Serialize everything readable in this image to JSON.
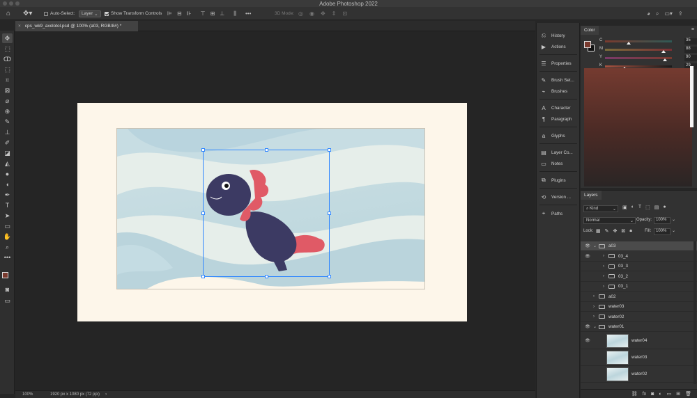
{
  "app": {
    "title": "Adobe Photoshop 2022"
  },
  "options_bar": {
    "auto_select_label": "Auto-Select:",
    "auto_select_value": "Layer",
    "show_transform_label": "Show Transform Controls",
    "mode_3d_label": "3D Mode:"
  },
  "document": {
    "tab_label": "cps_wk9_axolotol.psd @ 100% (a03, RGB/8#) *",
    "zoom": "100%",
    "dimensions": "1920 px x 1080 px (72 ppi)"
  },
  "dock": [
    {
      "label": "History",
      "icon": "history-icon"
    },
    {
      "label": "Actions",
      "icon": "play-icon"
    },
    {
      "label": "Properties",
      "icon": "sliders-icon"
    },
    {
      "label": "Brush Set...",
      "icon": "brush-icon"
    },
    {
      "label": "Brushes",
      "icon": "brushes-icon"
    },
    {
      "label": "Character",
      "icon": "character-icon"
    },
    {
      "label": "Paragraph",
      "icon": "paragraph-icon"
    },
    {
      "label": "Glyphs",
      "icon": "glyphs-icon"
    },
    {
      "label": "Layer Co...",
      "icon": "layer-comps-icon"
    },
    {
      "label": "Notes",
      "icon": "notes-icon"
    },
    {
      "label": "Plugins",
      "icon": "plugins-icon"
    },
    {
      "label": "Version ...",
      "icon": "version-icon"
    },
    {
      "label": "Paths",
      "icon": "paths-icon"
    }
  ],
  "color_panel": {
    "tab": "Color",
    "foreground": "#7a3a2e",
    "sliders": [
      {
        "label": "C",
        "value": "35",
        "unit": "%",
        "fraction": 0.35
      },
      {
        "label": "M",
        "value": "88",
        "unit": "%",
        "fraction": 0.88
      },
      {
        "label": "Y",
        "value": "90",
        "unit": "%",
        "fraction": 0.9
      },
      {
        "label": "K",
        "value": "29",
        "unit": "%",
        "fraction": 0.29
      }
    ]
  },
  "layers_panel": {
    "tab": "Layers",
    "filter_value": "Kind",
    "blend_mode": "Normal",
    "opacity_label": "Opacity:",
    "opacity_value": "100%",
    "lock_label": "Lock:",
    "fill_label": "Fill:",
    "fill_value": "100%",
    "layers": [
      {
        "name": "a03",
        "level": 0,
        "type": "group",
        "expanded": true,
        "visible": true,
        "selected": true
      },
      {
        "name": "03_4",
        "level": 1,
        "type": "group",
        "expanded": false,
        "visible": true
      },
      {
        "name": "03_3",
        "level": 1,
        "type": "group",
        "expanded": false,
        "visible": false
      },
      {
        "name": "03_2",
        "level": 1,
        "type": "group",
        "expanded": false,
        "visible": false
      },
      {
        "name": "03_1",
        "level": 1,
        "type": "group",
        "expanded": false,
        "visible": false
      },
      {
        "name": "a02",
        "level": 0,
        "type": "group",
        "expanded": false,
        "visible": false
      },
      {
        "name": "water03",
        "level": 0,
        "type": "group",
        "expanded": false,
        "visible": false
      },
      {
        "name": "water02",
        "level": 0,
        "type": "group",
        "expanded": false,
        "visible": false
      },
      {
        "name": "water01",
        "level": 0,
        "type": "group",
        "expanded": true,
        "visible": true
      },
      {
        "name": "water04",
        "level": 1,
        "type": "image",
        "visible": true
      },
      {
        "name": "water03",
        "level": 1,
        "type": "image",
        "visible": false
      },
      {
        "name": "water02",
        "level": 1,
        "type": "image",
        "visible": false
      }
    ]
  }
}
